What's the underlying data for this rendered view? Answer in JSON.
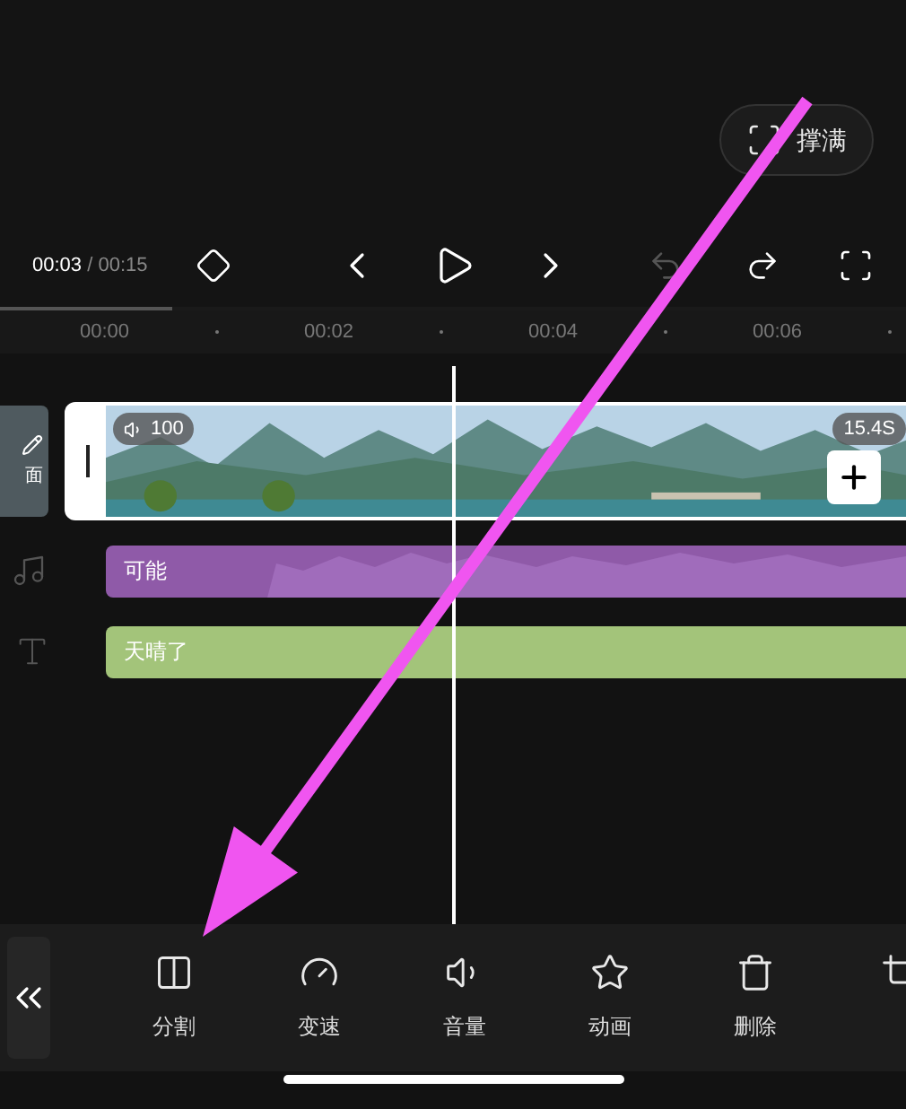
{
  "fill_button": {
    "label": "撑满"
  },
  "playback": {
    "current": "00:03",
    "total": "/ 00:15"
  },
  "progress": {
    "level": 0.19
  },
  "ruler": [
    "00:00",
    "00:02",
    "00:04",
    "00:06"
  ],
  "cover": {
    "label": "面"
  },
  "video_clip": {
    "volume": "100",
    "duration": "15.4S"
  },
  "audio_clip": {
    "label": "可能"
  },
  "text_clip": {
    "label": "天晴了"
  },
  "tools": [
    {
      "kind": "split",
      "label": "分割"
    },
    {
      "kind": "speed",
      "label": "变速"
    },
    {
      "kind": "volume",
      "label": "音量"
    },
    {
      "kind": "animation",
      "label": "动画"
    },
    {
      "kind": "delete",
      "label": "删除"
    },
    {
      "kind": "crop"
    }
  ]
}
